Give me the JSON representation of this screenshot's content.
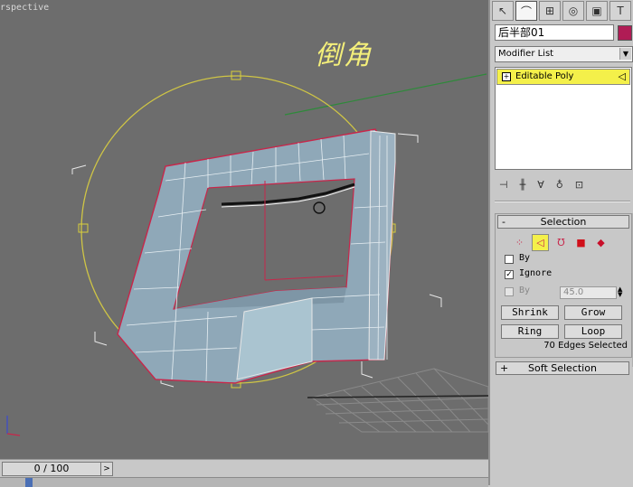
{
  "viewport": {
    "label": "rspective",
    "annotation": "倒角"
  },
  "timeline": {
    "frame": "0 / 100",
    "next_glyph": ">"
  },
  "panel": {
    "tabs": [
      "create",
      "modify",
      "hierarchy",
      "motion",
      "display",
      "utilities"
    ],
    "object_name": "后半部01",
    "object_color": "#b01c55",
    "modifier_list": "Modifier List",
    "stack_item": "Editable Poly",
    "selection": {
      "title": "Selection",
      "by_vertex": "By",
      "ignore_backfacing": "Ignore",
      "by_angle": "By",
      "angle_value": "45.0",
      "shrink": "Shrink",
      "grow": "Grow",
      "ring": "Ring",
      "loop": "Loop",
      "status": "70 Edges Selected"
    },
    "soft_selection": {
      "title": "Soft Selection"
    }
  }
}
